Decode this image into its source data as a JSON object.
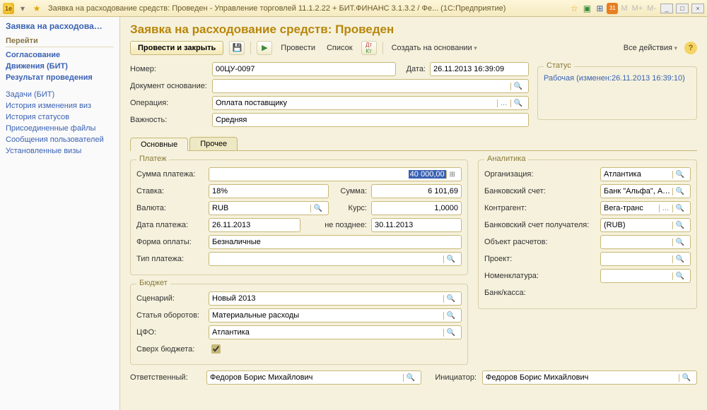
{
  "titlebar": {
    "logo_text": "1e",
    "title": "Заявка на расходование средств: Проведен - Управление торговлей 11.1.2.22 + БИТ.ФИНАНС 3.1.3.2 / Фе...   (1С:Предприятие)",
    "m_labels": [
      "M",
      "M+",
      "M-"
    ]
  },
  "sidebar": {
    "title": "Заявка на расходова…",
    "section": "Перейти",
    "bold_links": [
      "Согласование",
      "Движения (БИТ)",
      "Результат проведения"
    ],
    "plain_links": [
      "Задачи (БИТ)",
      "История изменения виз",
      "История статусов",
      "Присоединенные файлы",
      "Сообщения пользователей",
      "Установленные визы"
    ]
  },
  "page": {
    "title": "Заявка на расходование средств: Проведен"
  },
  "toolbar": {
    "post_close": "Провести и закрыть",
    "post": "Провести",
    "list": "Список",
    "create_based": "Создать на основании",
    "all_actions": "Все действия"
  },
  "header": {
    "number_label": "Номер:",
    "number": "00ЦУ-0097",
    "date_label": "Дата:",
    "date": "26.11.2013 16:39:09",
    "doc_base_label": "Документ основание:",
    "doc_base": "",
    "operation_label": "Операция:",
    "operation": "Оплата поставщику",
    "importance_label": "Важность:",
    "importance": "Средняя",
    "status_legend": "Статус",
    "status_text": "Рабочая (изменен:26.11.2013 16:39:10)"
  },
  "tabs": {
    "main": "Основные",
    "other": "Прочее"
  },
  "payment": {
    "legend": "Платеж",
    "amount_label": "Сумма платежа:",
    "amount": "40 000,00",
    "rate_label": "Ставка:",
    "rate": "18%",
    "sum_label": "Сумма:",
    "sum": "6 101,69",
    "currency_label": "Валюта:",
    "currency": "RUB",
    "course_label": "Курс:",
    "course": "1,0000",
    "pay_date_label": "Дата платежа:",
    "pay_date": "26.11.2013",
    "due_label": "не позднее:",
    "due": "30.11.2013",
    "pay_form_label": "Форма оплаты:",
    "pay_form": "Безналичные",
    "pay_type_label": "Тип платежа:",
    "pay_type": ""
  },
  "budget": {
    "legend": "Бюджет",
    "scenario_label": "Сценарий:",
    "scenario": "Новый 2013",
    "turnover_label": "Статья оборотов:",
    "turnover": "Материальные расходы",
    "cfo_label": "ЦФО:",
    "cfo": "Атлантика",
    "over_budget_label": "Сверх бюджета:"
  },
  "analytics": {
    "legend": "Аналитика",
    "org_label": "Организация:",
    "org": "Атлантика",
    "bank_acc_label": "Банковский счет:",
    "bank_acc": "Банк \"Альфа\", Атлантика",
    "contragent_label": "Контрагент:",
    "contragent": "Вега-транс",
    "recv_bank_label": "Банковский счет получателя:",
    "recv_bank": "(RUB)",
    "calc_obj_label": "Объект расчетов:",
    "calc_obj": "",
    "project_label": "Проект:",
    "project": "",
    "nomenclature_label": "Номенклатура:",
    "nomenclature": "",
    "bank_cash_label": "Банк/касса:",
    "bank_cash": ""
  },
  "footer": {
    "responsible_label": "Ответственный:",
    "responsible": "Федоров Борис Михайлович",
    "initiator_label": "Инициатор:",
    "initiator": "Федоров Борис Михайлович"
  }
}
